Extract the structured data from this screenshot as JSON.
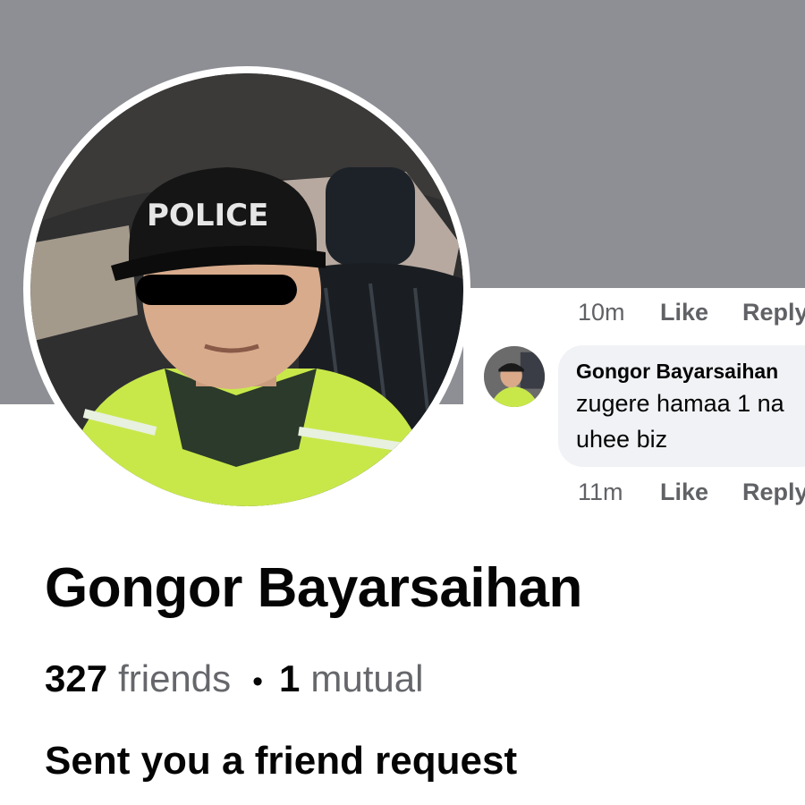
{
  "profile": {
    "name": "Gongor Bayarsaihan",
    "friends_count": "327",
    "friends_label": "friends",
    "separator": "•",
    "mutual_count": "1",
    "mutual_label": "mutual",
    "request_text": "Sent you a friend request",
    "avatar_cap_text": "POLICE"
  },
  "comment_thread": {
    "prev_meta": {
      "time": "10m",
      "like": "Like",
      "reply": "Reply"
    },
    "comment": {
      "author": "Gongor Bayarsaihan",
      "text_line1": "zugere hamaa 1 na",
      "text_line2": "uhee biz"
    },
    "comment_meta": {
      "time": "11m",
      "like": "Like",
      "reply": "Reply"
    }
  },
  "colors": {
    "cover": "#8e8f94",
    "bubble": "#f0f2f5",
    "muted_text": "#65676b",
    "vest": "#c8e84a"
  }
}
